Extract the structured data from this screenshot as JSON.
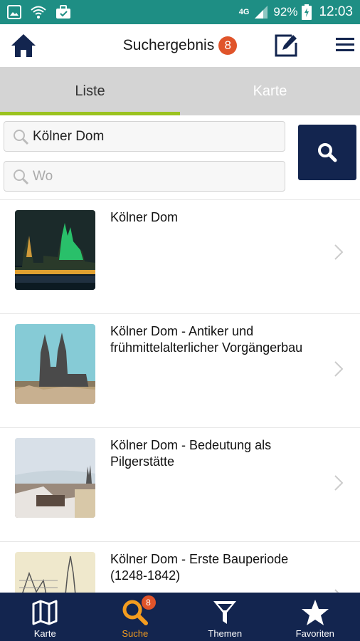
{
  "status_bar": {
    "network": "4G",
    "battery": "92%",
    "time": "12:03",
    "icons": [
      "image-icon",
      "wifi-icon",
      "briefcase-icon",
      "signal-icon",
      "battery-charging-icon"
    ]
  },
  "header": {
    "title": "Suchergebnis",
    "result_count": "8",
    "icons": [
      "home-icon",
      "edit-icon",
      "hamburger-menu-icon"
    ]
  },
  "tabs": [
    {
      "label": "Liste",
      "active": true
    },
    {
      "label": "Karte",
      "active": false
    }
  ],
  "search": {
    "what_value": "Kölner Dom",
    "where_placeholder": "Wo",
    "icon": "search-icon"
  },
  "results": [
    {
      "title": "Kölner Dom"
    },
    {
      "title": "Kölner Dom - Antiker und frühmittelalterlicher Vorgängerbau"
    },
    {
      "title": "Kölner Dom - Bedeutung als Pilgerstätte"
    },
    {
      "title": "Kölner Dom - Erste Bauperiode (1248-1842)"
    }
  ],
  "bottom_nav": [
    {
      "label": "Karte",
      "icon": "map-icon",
      "active": false
    },
    {
      "label": "Suche",
      "icon": "search-icon",
      "active": true,
      "badge": "8"
    },
    {
      "label": "Themen",
      "icon": "filter-icon",
      "active": false
    },
    {
      "label": "Favoriten",
      "icon": "star-icon",
      "active": false
    }
  ],
  "colors": {
    "status_bar": "#1e8e84",
    "brand_navy": "#13254f",
    "accent_green": "#9bc31f",
    "badge_red": "#e0542a",
    "active_orange": "#f39c1f"
  }
}
